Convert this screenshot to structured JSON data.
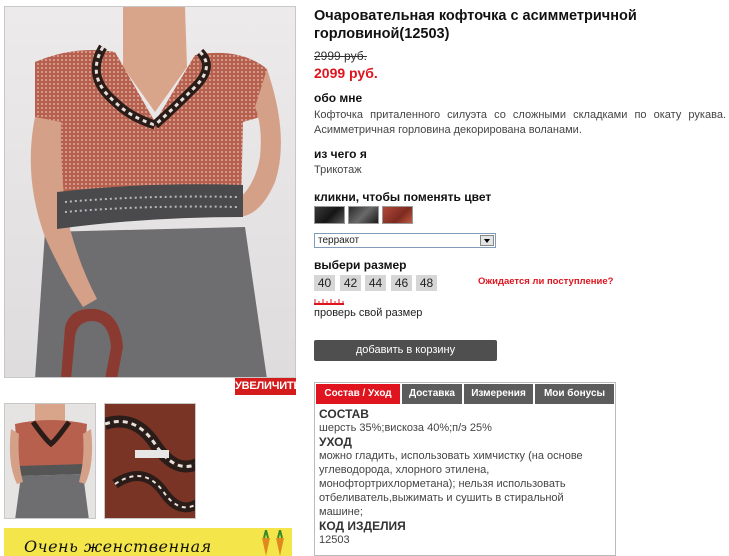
{
  "product": {
    "title": "Очаровательная кофточка с асимметричной горловиной(12503)",
    "old_price": "2999 руб.",
    "new_price": "2099 руб."
  },
  "gallery": {
    "zoom_label": "УВЕЛИЧИТЬ",
    "banner_text": "Очень женственная"
  },
  "about": {
    "heading": "обо мне",
    "text": "Кофточка приталенного силуэта со сложными складками по окату рукава. Асимметричная горловина декорирована воланами."
  },
  "material": {
    "heading": "из чего я",
    "text": "Трикотаж"
  },
  "color": {
    "heading": "кликни, чтобы поменять цвет",
    "selected": "терракот",
    "swatches": [
      "black-swatch",
      "dark-gray-swatch",
      "terracotta-swatch"
    ],
    "accent": "#e0141e"
  },
  "size": {
    "heading": "выбери размер",
    "options": [
      "40",
      "42",
      "44",
      "46",
      "48"
    ],
    "expect_link": "Ожидается ли поступление?",
    "check_link": "проверь свой размер"
  },
  "cart": {
    "add_label": "добавить в корзину"
  },
  "tabs": {
    "items": [
      "Состав / Уход",
      "Доставка",
      "Измерения",
      "Мои бонусы"
    ],
    "active": "Состав / Уход",
    "content": {
      "composition_h": "СОСТАВ",
      "composition": "шерсть 35%;вискоза 40%;п/э 25%",
      "care_h": "УХОД",
      "care": "можно гладить, использовать химчистку (на основе углеводорода, хлорного этилена, монофтортрихлорметана); нельзя использовать отбеливатель,выжимать и сушить в стиральной машине;",
      "code_h": "КОД ИЗДЕЛИЯ",
      "code": "12503"
    }
  }
}
